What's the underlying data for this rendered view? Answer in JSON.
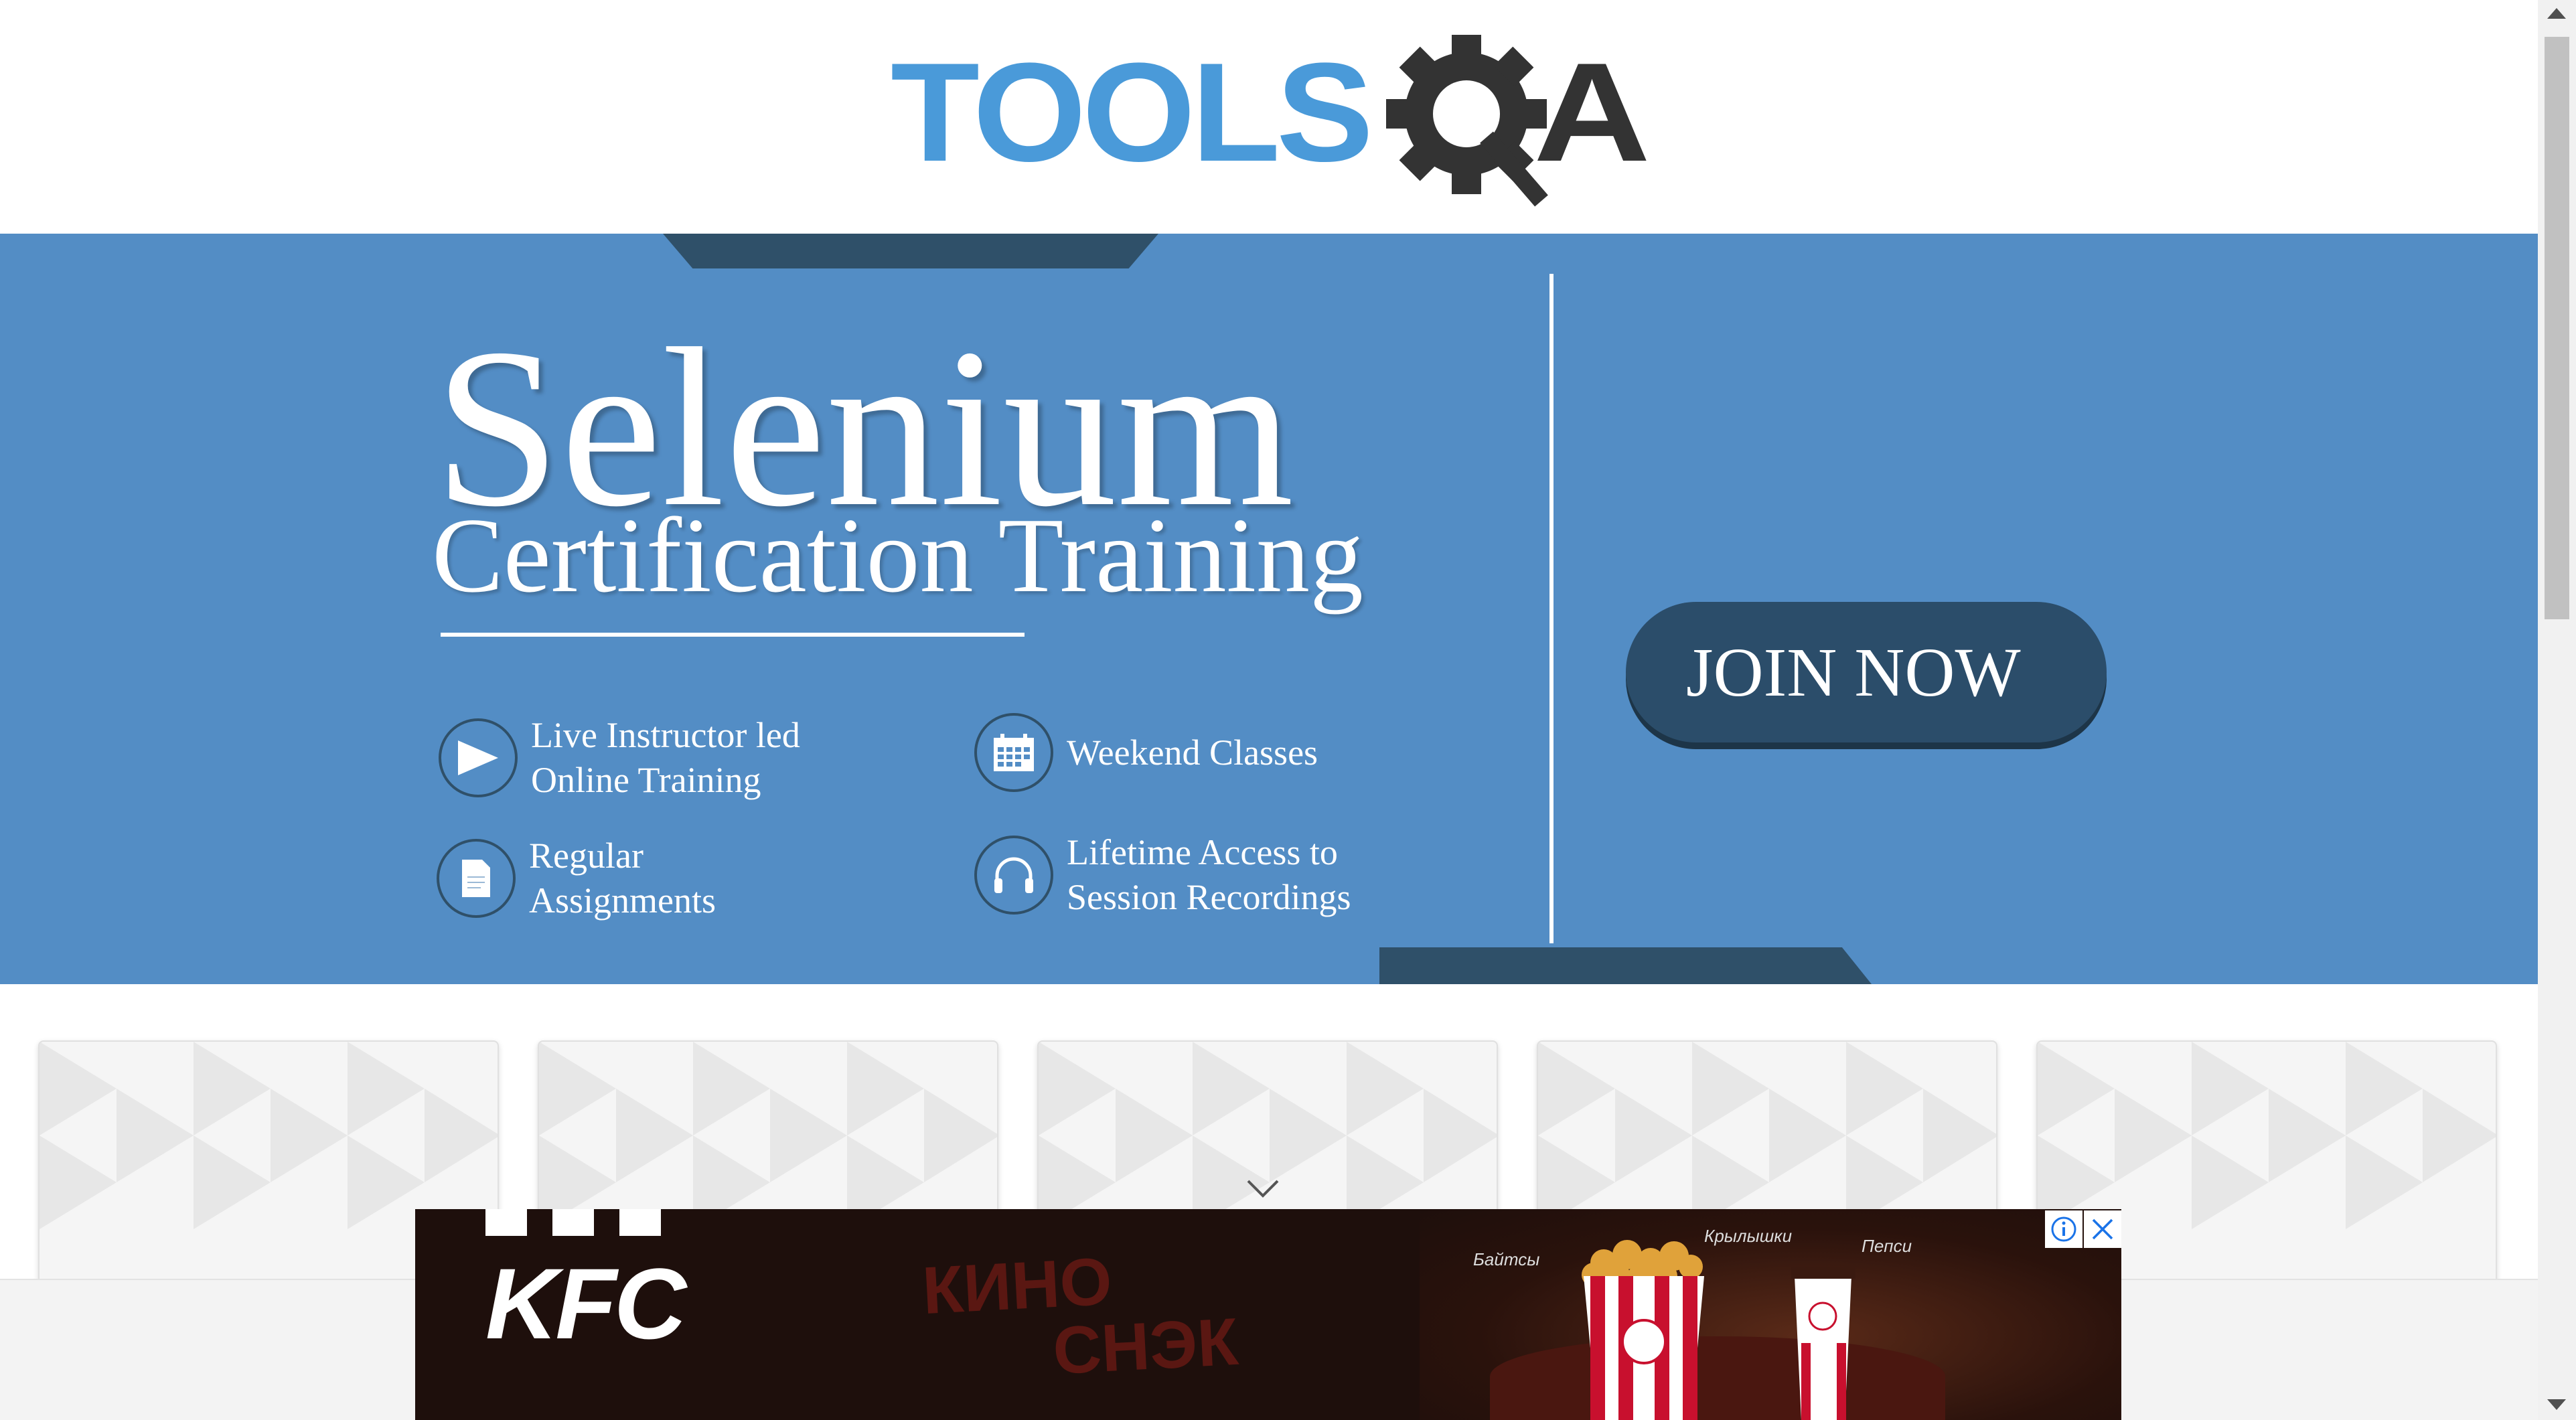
{
  "logo": {
    "text_tools": "TOOLS",
    "text_qa": "QA",
    "tools_color": "#4a9ad9",
    "qa_color": "#333333"
  },
  "banner": {
    "title": "Selenium",
    "subtitle": "Certification Training",
    "features": [
      {
        "icon": "play-icon",
        "line1": "Live Instructor led",
        "line2": "Online Training"
      },
      {
        "icon": "calendar-icon",
        "line1": "Weekend Classes",
        "line2": ""
      },
      {
        "icon": "document-icon",
        "line1": "Regular",
        "line2": "Assignments"
      },
      {
        "icon": "headphones-icon",
        "line1": "Lifetime Access to",
        "line2": "Session Recordings"
      }
    ],
    "cta_label": "JOIN NOW",
    "background_color": "#538dc5",
    "accent_color": "#2f5069"
  },
  "ad": {
    "brand": "KFC",
    "promo_line1": "КИНО",
    "promo_line2": "СНЭК",
    "labels": [
      "Байтсы",
      "Крылышки",
      "Пепси"
    ],
    "info_icon": "info-icon",
    "close_icon": "close-icon"
  },
  "colors": {
    "scrollbar_thumb": "#c1c1c1",
    "ad_background": "#1e0f0c"
  }
}
